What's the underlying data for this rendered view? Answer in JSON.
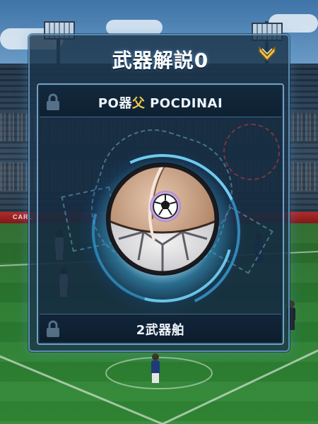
{
  "panel": {
    "title": "武器解説0",
    "close_icon": "chevron-down-icon",
    "accent_color": "#f2c84b"
  },
  "weapon": {
    "name_prefix": "PO器",
    "name_accent": "父",
    "name_suffix": " POCDINAI",
    "footer_label": "2武器舶",
    "lock_icon": "lock-icon"
  },
  "background": {
    "adboard_text": "CARL"
  }
}
